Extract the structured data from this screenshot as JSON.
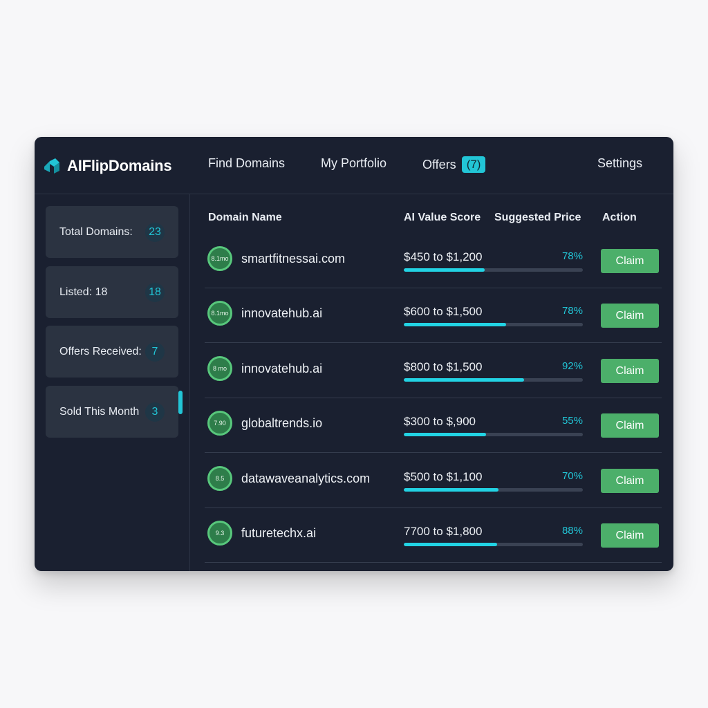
{
  "app": {
    "name": "AIFlipDomains",
    "accent_color": "#22c5d6",
    "claim_color": "#4caf6a"
  },
  "nav": {
    "find_domains": "Find Domains",
    "my_portfolio": "My Portfolio",
    "offers": "Offers",
    "offers_count": "(7)",
    "settings": "Settings"
  },
  "sidebar": {
    "stats": [
      {
        "label": "Total Domains:",
        "count": "23"
      },
      {
        "label": "Listed: 18",
        "count": "18"
      },
      {
        "label": "Offers Received:",
        "count": "7"
      },
      {
        "label": "Sold This Month",
        "count": "3"
      }
    ]
  },
  "table": {
    "headers": {
      "domain": "Domain Name",
      "score": "AI Value Score",
      "price": "Suggested Price",
      "action": "Action"
    },
    "rows": [
      {
        "score": "8.1mo",
        "domain": "smartfitnessai.com",
        "price": "$450 to $1,200",
        "percent": "78%",
        "fill": 0.45,
        "action": "Claim"
      },
      {
        "score": "8.1mo",
        "domain": "innovatehub.ai",
        "price": "$600 to $1,500",
        "percent": "78%",
        "fill": 0.57,
        "action": "Claim"
      },
      {
        "score": "8 mo",
        "domain": "innovatehub.ai",
        "price": "$800 to $1,500",
        "percent": "92%",
        "fill": 0.67,
        "action": "Claim"
      },
      {
        "score": "7.90",
        "domain": "globaltrends.io",
        "price": "$300 to $,900",
        "percent": "55%",
        "fill": 0.46,
        "action": "Claim"
      },
      {
        "score": "8.5",
        "domain": "datawaveanalytics.com",
        "price": "$500 to $1,100",
        "percent": "70%",
        "fill": 0.53,
        "action": "Claim"
      },
      {
        "score": "9.3",
        "domain": "futuretechx.ai",
        "price": "7700 to $1,800",
        "percent": "88%",
        "fill": 0.52,
        "action": "Claim"
      }
    ]
  }
}
